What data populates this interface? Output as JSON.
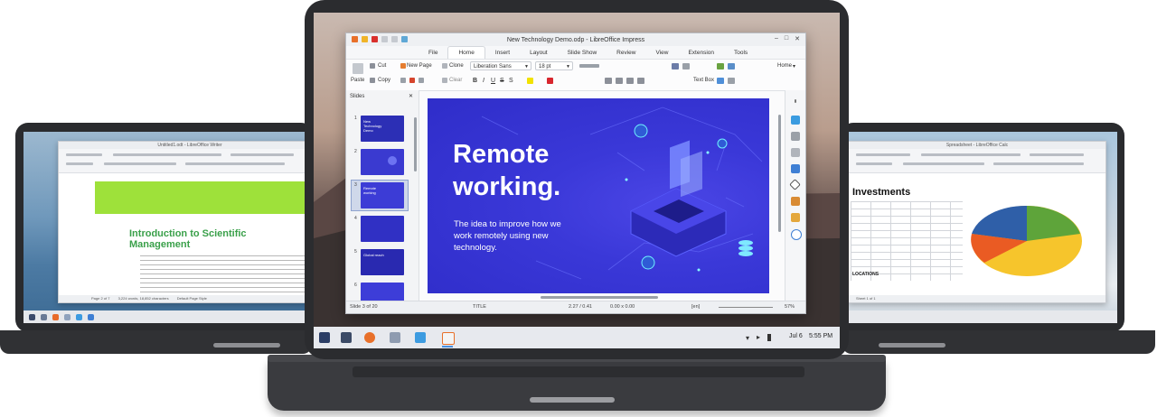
{
  "left_laptop": {
    "window_title": "Untitled1.odt - LibreOffice Writer",
    "doc_heading_line1": "Introduction to Scientific",
    "doc_heading_line2": "Management",
    "status_left": "Page 2 of 7",
    "status_words": "3,224 words, 18,852 characters",
    "status_style": "Default Page Style",
    "accent_color": "#9ee13a"
  },
  "right_laptop": {
    "window_title": "Spreadsheet - LibreOffice Calc",
    "sheet_heading": "Investments",
    "row_label": "LOCATIONS",
    "status": "Sheet 1 of 1"
  },
  "impress": {
    "window_title": "New Technology Demo.odp - LibreOffice Impress",
    "tabs": [
      "File",
      "Home",
      "Insert",
      "Layout",
      "Slide Show",
      "Review",
      "View",
      "Extension",
      "Tools"
    ],
    "active_tab": "Home",
    "ribbon": {
      "paste": "Paste",
      "cut": "Cut",
      "copy": "Copy",
      "clone": "Clone",
      "clear": "Clear",
      "new_page": "New Page",
      "font_name": "Liberation Sans",
      "font_size": "18 pt",
      "textbox": "Text Box",
      "home_dropdown": "Home"
    },
    "slides_panel_title": "Slides",
    "slide_numbers": [
      "1",
      "2",
      "3",
      "4",
      "5",
      "6"
    ],
    "thumbnails": [
      {
        "label": "New Technology Demo",
        "color": "#2c2fb5"
      },
      {
        "label": "",
        "color": "#3a3ad0"
      },
      {
        "label": "Remote working",
        "color": "#3c3cd6"
      },
      {
        "label": "",
        "color": "#3030c4"
      },
      {
        "label": "Global reach",
        "color": "#2929b0"
      },
      {
        "label": "",
        "color": "#3d3dd8"
      }
    ],
    "selected_slide_index": 2,
    "slide": {
      "title_line1": "Remote",
      "title_line2": "working.",
      "subtitle_line1": "The idea to improve how we",
      "subtitle_line2": "work remotely using new",
      "subtitle_line3": "technology."
    },
    "status": {
      "slide_pos": "Slide 3 of 20",
      "layout": "TITLE",
      "position": "2.27 / 0.41",
      "size": "0.00 x 0.00",
      "lang": "[en]",
      "zoom": "57%"
    }
  },
  "panel": {
    "clock_date": "Jul 6",
    "clock_time": "5:55 PM"
  },
  "colors": {
    "slide_bg": "#3633d4",
    "lid": "#2b2c2f",
    "panel": "#e7e9ee"
  }
}
